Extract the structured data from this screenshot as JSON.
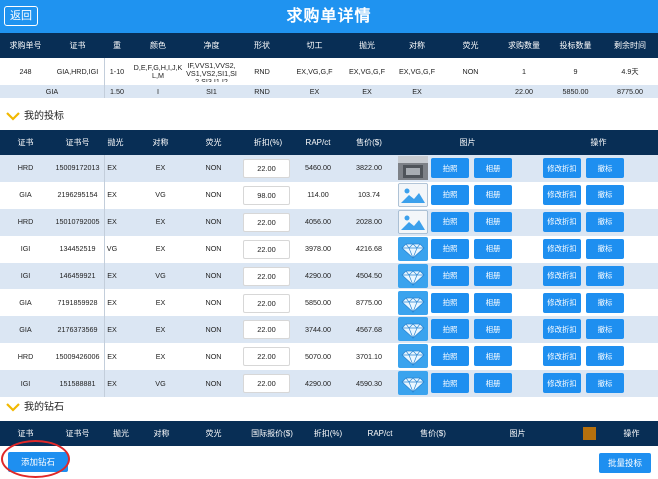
{
  "header": {
    "back_label": "返回",
    "title": "求购单详情"
  },
  "order_table": {
    "headers": [
      "求购单号",
      "证书",
      "重量",
      "颜色",
      "净度",
      "形状",
      "切工",
      "抛光",
      "对称",
      "荧光",
      "求购数量",
      "投标数量",
      "剩余时间"
    ],
    "headers_short": [
      "求购单号",
      "证书",
      "重",
      "颜色",
      "净度",
      "形状",
      "切工",
      "抛光",
      "对称",
      "荧光",
      "求购数量",
      "投标数量",
      "剩余时间"
    ],
    "row": {
      "order_no": "248",
      "cert": "GIA,HRD,IGI",
      "weight": "1-10",
      "color_line1": "D,E,F,G,H,I,J,K",
      "color_line2": "L,M",
      "clarity_line1": "IF,VVS1,VVS2,",
      "clarity_line2": "VS1,VS2,SI1,SI",
      "clarity_line3": "2,SI3,I1,I2",
      "shape": "RND",
      "cut": "EX,VG,G,F",
      "polish": "EX,VG,G,F",
      "symmetry": "EX,VG,G,F",
      "fluorescence": "NON",
      "qty": "1",
      "bid_qty": "9",
      "remaining": "4.9天"
    },
    "summary": {
      "cert": "GIA",
      "weight": "1.50",
      "color": "I",
      "clarity": "SI1",
      "shape": "RND",
      "cut": "EX",
      "polish": "EX",
      "symmetry": "EX",
      "price1": "22.00",
      "price2": "5850.00",
      "price3": "8775.00"
    }
  },
  "my_bids": {
    "section_title": "我的投标",
    "headers": [
      "证书",
      "证书号",
      "抛光",
      "对称",
      "荧光",
      "折扣(%)",
      "RAP/ct",
      "售价($)",
      "图片",
      "操作"
    ],
    "btn_photo": "拍照",
    "btn_album": "相册",
    "btn_edit": "修改折扣",
    "btn_withdraw": "撤标",
    "rows": [
      {
        "cert": "HRD",
        "cert_no": "15009172013",
        "polish": "EX",
        "symmetry": "EX",
        "fluor": "NON",
        "discount": "22.00",
        "rap": "5460.00",
        "price": "3822.00",
        "img": "photo"
      },
      {
        "cert": "GIA",
        "cert_no": "2196295154",
        "polish": "EX",
        "symmetry": "VG",
        "fluor": "NON",
        "discount": "98.00",
        "rap": "114.00",
        "price": "103.74",
        "img": "placeholder"
      },
      {
        "cert": "HRD",
        "cert_no": "15010792005",
        "polish": "EX",
        "symmetry": "EX",
        "fluor": "NON",
        "discount": "22.00",
        "rap": "4056.00",
        "price": "2028.00",
        "img": "placeholder"
      },
      {
        "cert": "IGI",
        "cert_no": "134452519",
        "polish": "VG",
        "symmetry": "EX",
        "fluor": "NON",
        "discount": "22.00",
        "rap": "3978.00",
        "price": "4216.68",
        "img": "diamond"
      },
      {
        "cert": "IGI",
        "cert_no": "146459921",
        "polish": "EX",
        "symmetry": "VG",
        "fluor": "NON",
        "discount": "22.00",
        "rap": "4290.00",
        "price": "4504.50",
        "img": "diamond"
      },
      {
        "cert": "GIA",
        "cert_no": "7191859928",
        "polish": "EX",
        "symmetry": "EX",
        "fluor": "NON",
        "discount": "22.00",
        "rap": "5850.00",
        "price": "8775.00",
        "img": "diamond"
      },
      {
        "cert": "GIA",
        "cert_no": "2176373569",
        "polish": "EX",
        "symmetry": "EX",
        "fluor": "NON",
        "discount": "22.00",
        "rap": "3744.00",
        "price": "4567.68",
        "img": "diamond"
      },
      {
        "cert": "HRD",
        "cert_no": "15009426006",
        "polish": "EX",
        "symmetry": "EX",
        "fluor": "NON",
        "discount": "22.00",
        "rap": "5070.00",
        "price": "3701.10",
        "img": "diamond"
      },
      {
        "cert": "IGI",
        "cert_no": "151588881",
        "polish": "EX",
        "symmetry": "VG",
        "fluor": "NON",
        "discount": "22.00",
        "rap": "4290.00",
        "price": "4590.30",
        "img": "diamond"
      }
    ]
  },
  "my_diamonds": {
    "section_title": "我的钻石",
    "headers": [
      "证书",
      "证书号",
      "抛光",
      "对称",
      "荧光",
      "国际报价($)",
      "折扣(%)",
      "RAP/ct",
      "售价($)",
      "图片",
      "操作"
    ]
  },
  "footer": {
    "add_label": "添加钻石",
    "batch_label": "批量投标"
  },
  "colors": {
    "primary": "#1f93f0",
    "header_bg": "#082e55",
    "row_alt": "#dbe6f3",
    "highlight": "#e02828"
  }
}
